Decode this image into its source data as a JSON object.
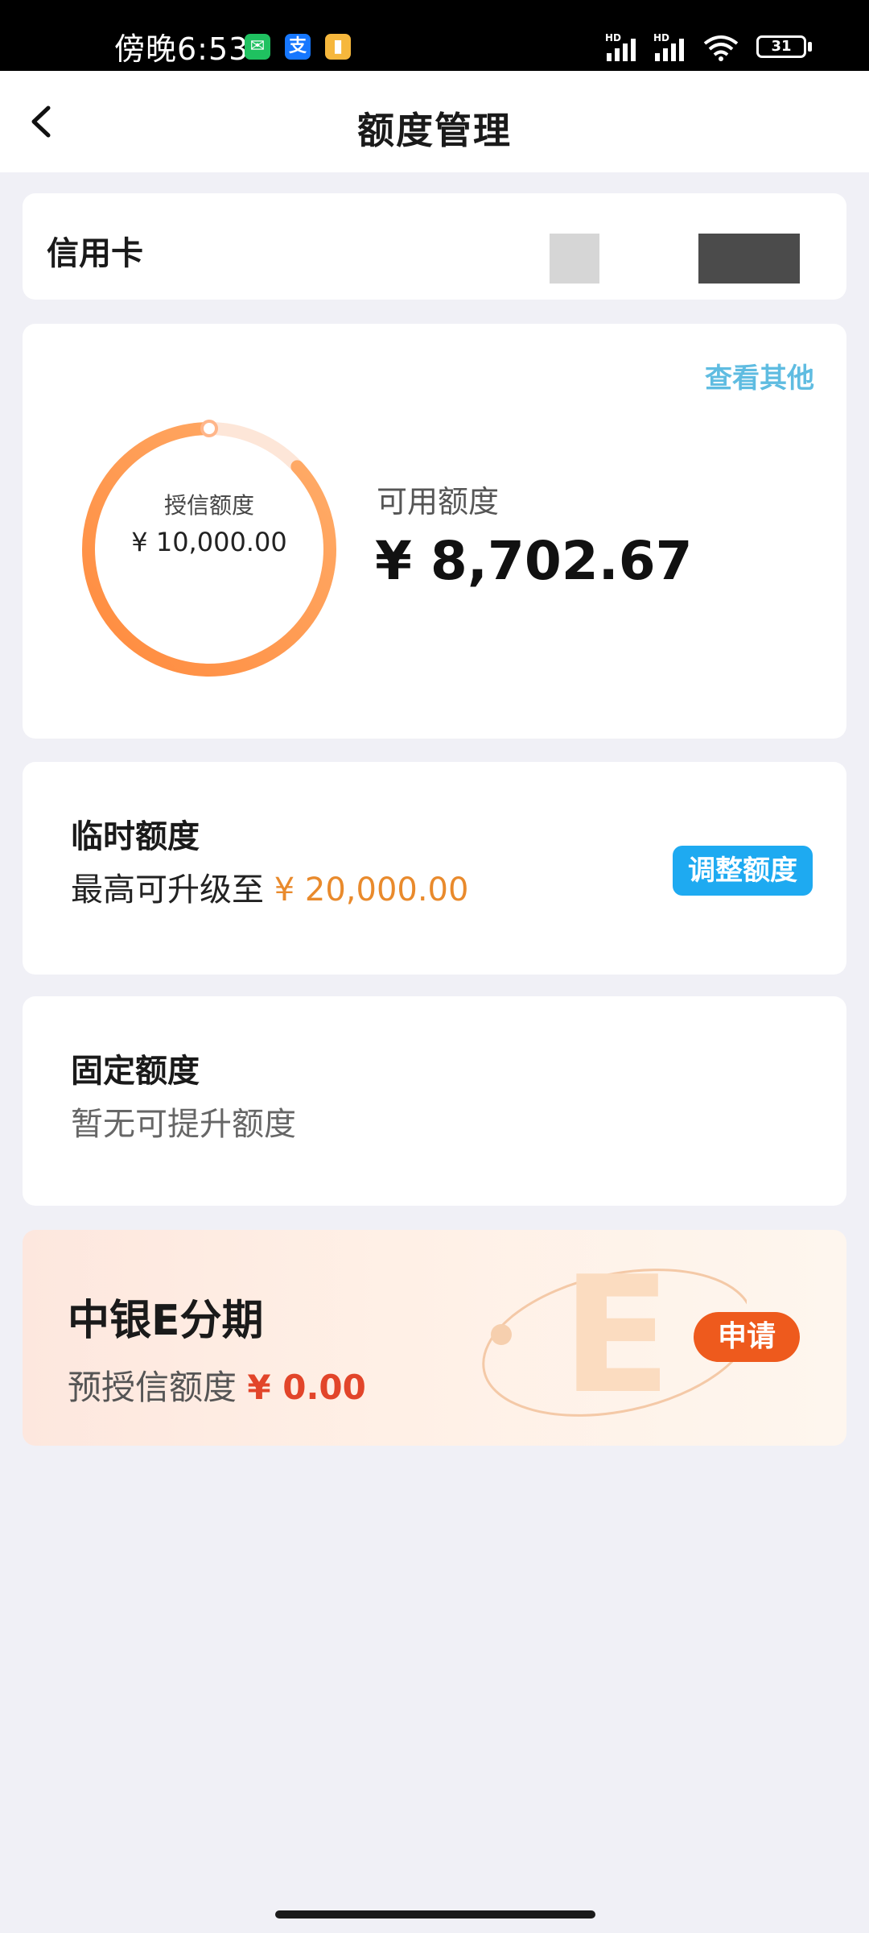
{
  "status_bar": {
    "time": "傍晚6:53",
    "apps": [
      "wechat-icon",
      "alipay-icon",
      "notes-icon"
    ],
    "battery": "31",
    "hd": "HD"
  },
  "nav": {
    "title": "额度管理"
  },
  "credit_card": {
    "label": "信用卡"
  },
  "limit": {
    "view_other": "查看其他",
    "credit_label": "授信额度",
    "credit_value": "¥ 10,000.00",
    "available_label": "可用额度",
    "available_value": "¥ 8,702.67",
    "used_fraction": 0.87
  },
  "temporary": {
    "title": "临时额度",
    "sub_prefix": "最高可升级至",
    "sub_amount": "¥ 20,000.00",
    "button": "调整额度"
  },
  "fixed": {
    "title": "固定额度",
    "sub": "暂无可提升额度"
  },
  "e_installment": {
    "title": "中银E分期",
    "sub_prefix": "预授信额度",
    "sub_amount": "¥ 0.00",
    "button": "申请"
  },
  "colors": {
    "accent_orange": "#e98a2c",
    "button_blue": "#1eaaf1",
    "button_orange": "#ee5a1d",
    "amount_red": "#e2452a"
  }
}
